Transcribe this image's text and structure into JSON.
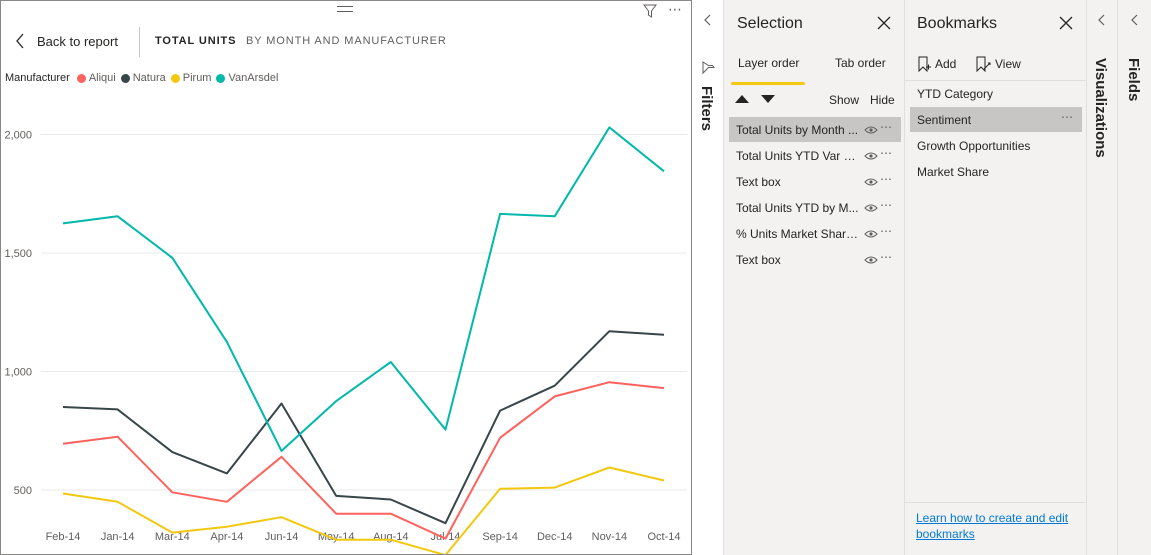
{
  "report": {
    "back_label": "Back to report",
    "title_main": "TOTAL UNITS",
    "title_sub": "BY MONTH AND MANUFACTURER",
    "legend_title": "Manufacturer"
  },
  "chart_data": {
    "type": "line",
    "title": "TOTAL UNITS BY MONTH AND MANUFACTURER",
    "categories": [
      "Feb-14",
      "Jan-14",
      "Mar-14",
      "Apr-14",
      "Jun-14",
      "May-14",
      "Aug-14",
      "Jul-14",
      "Sep-14",
      "Dec-14",
      "Nov-14",
      "Oct-14"
    ],
    "yticks": [
      500,
      1000,
      1500,
      2000
    ],
    "ytick_labels": [
      "500",
      "1,000",
      "1,500",
      "2,000"
    ],
    "ylim": [
      310,
      2150
    ],
    "grid": true,
    "legend_position": "top-left",
    "series": [
      {
        "name": "Aliqui",
        "color": "#fd625e",
        "values": [
          695,
          725,
          490,
          450,
          640,
          400,
          400,
          295,
          720,
          895,
          955,
          930
        ]
      },
      {
        "name": "Natura",
        "color": "#374649",
        "values": [
          850,
          840,
          660,
          570,
          865,
          475,
          460,
          360,
          835,
          940,
          1170,
          1155
        ]
      },
      {
        "name": "Pirum",
        "color": "#f2c80f",
        "values": [
          485,
          450,
          320,
          345,
          385,
          290,
          290,
          225,
          505,
          510,
          595,
          540
        ]
      },
      {
        "name": "VanArsdel",
        "color": "#01b8aa",
        "values": [
          1625,
          1655,
          1480,
          1125,
          665,
          875,
          1040,
          755,
          1665,
          1655,
          2030,
          1845
        ]
      }
    ]
  },
  "filters": {
    "label": "Filters"
  },
  "selection": {
    "title": "Selection",
    "tab_layer": "Layer order",
    "tab_tab": "Tab order",
    "show_label": "Show",
    "hide_label": "Hide",
    "layers": [
      {
        "name": "Total Units by Month ..."
      },
      {
        "name": "Total Units YTD Var %..."
      },
      {
        "name": "Text box"
      },
      {
        "name": "Total Units YTD by M..."
      },
      {
        "name": "% Units Market Share..."
      },
      {
        "name": "Text box"
      }
    ]
  },
  "bookmarks": {
    "title": "Bookmarks",
    "add_label": "Add",
    "view_label": "View",
    "items": [
      {
        "name": "YTD Category"
      },
      {
        "name": "Sentiment"
      },
      {
        "name": "Growth Opportunities"
      },
      {
        "name": "Market Share"
      }
    ],
    "learn_link": "Learn how to create and edit bookmarks"
  },
  "visualizations": {
    "label": "Visualizations"
  },
  "fields": {
    "label": "Fields"
  }
}
